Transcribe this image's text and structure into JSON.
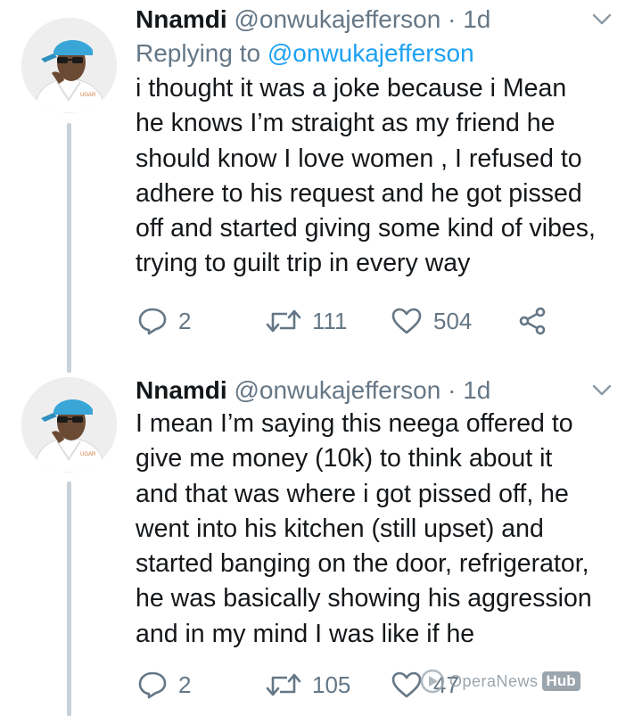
{
  "tweets": [
    {
      "author_name": "Nnamdi",
      "author_handle": "@onwukajefferson",
      "separator": "·",
      "time": "1d",
      "replying_prefix": "Replying to",
      "replying_mention": "@onwukajefferson",
      "text_lines": [
        "i thought it was a joke because i Mean",
        "he knows I’m straight as my friend he",
        "should know I love women , I refused to",
        "adhere to his request and he got pissed",
        "off and started giving some kind of vibes,",
        "trying to guilt trip in every way"
      ],
      "replies": "2",
      "retweets": "111",
      "likes": "504",
      "avatar_icon": "avatar-photo",
      "caret_icon": "chevron-down-icon"
    },
    {
      "author_name": "Nnamdi",
      "author_handle": "@onwukajefferson",
      "separator": "·",
      "time": "1d",
      "text_lines": [
        "I mean I’m saying this neega offered to",
        "give me money (10k) to think about it",
        "and that was where i got pissed off, he",
        "went into his kitchen (still upset) and",
        "started banging on the door, refrigerator,",
        "he was basically showing his aggression",
        "and in my mind I was like if he"
      ],
      "replies": "2",
      "retweets": "105",
      "likes": "47",
      "avatar_icon": "avatar-photo",
      "caret_icon": "chevron-down-icon"
    }
  ],
  "watermark": {
    "text": "OperaNews",
    "badge": "Hub"
  },
  "colors": {
    "text": "#14171a",
    "muted": "#657786",
    "link": "#1da1f2",
    "thread_line": "#c9d1d8"
  }
}
